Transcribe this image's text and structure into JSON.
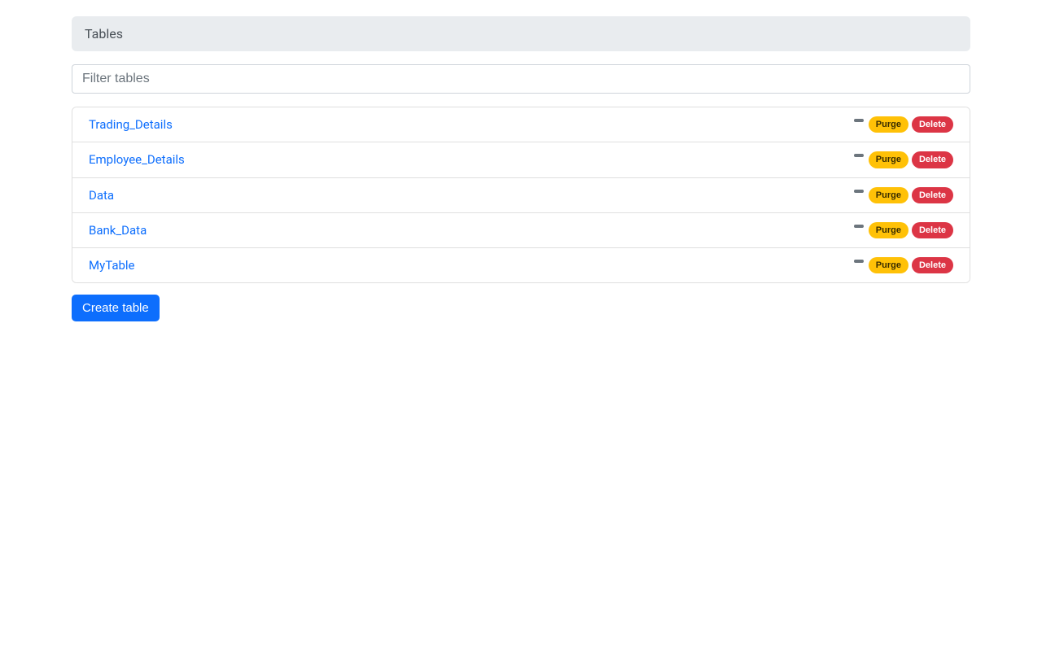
{
  "header": {
    "title": "Tables"
  },
  "filter": {
    "placeholder": "Filter tables",
    "value": ""
  },
  "row_actions": {
    "purge_label": "Purge",
    "delete_label": "Delete"
  },
  "tables": [
    {
      "name": "Trading_Details"
    },
    {
      "name": "Employee_Details"
    },
    {
      "name": "Data"
    },
    {
      "name": "Bank_Data"
    },
    {
      "name": "MyTable"
    }
  ],
  "buttons": {
    "create_label": "Create table"
  }
}
